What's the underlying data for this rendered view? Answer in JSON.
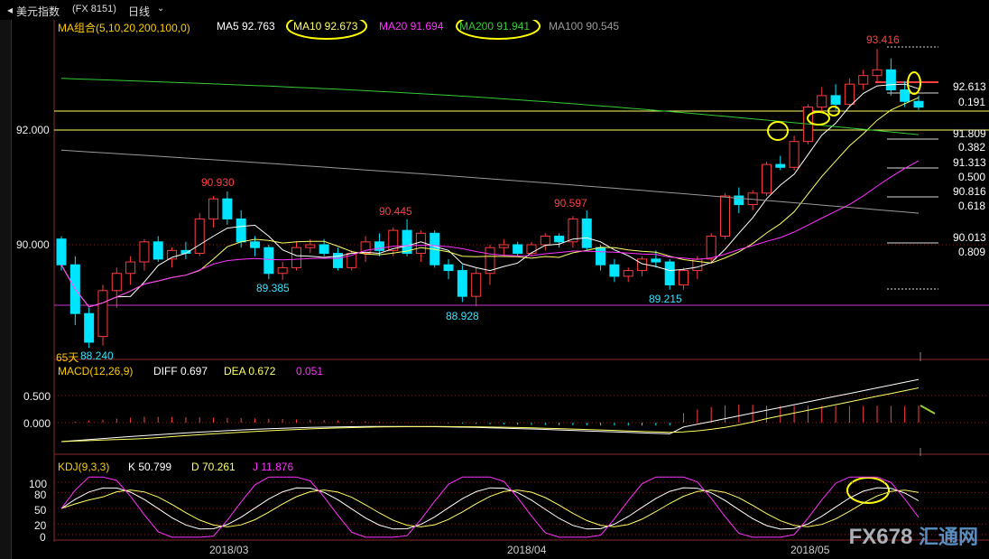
{
  "window": {
    "back_icon": "back-arrow-icon",
    "symbol": "美元指数",
    "code": "(FX 8151)",
    "period": "日线",
    "period_chevron": "chevron-down-icon"
  },
  "ma_legend": {
    "label": "MA组合(5,10,20,200,100,0)",
    "ma5": "MA5 92.763",
    "ma10": "MA10 92.673",
    "ma20": "MA20 91.694",
    "ma200": "MA200 91.941",
    "ma100": "MA100 90.545"
  },
  "price_axis": {
    "tick_92": "92.000",
    "tick_90": "90.000"
  },
  "price_annotations": {
    "high_label": "93.416",
    "p1": "90.930",
    "p2": "89.385",
    "p3": "90.445",
    "p4": "88.928",
    "p5": "90.597",
    "p6": "89.215",
    "low_label": "88.240",
    "low_prefix": "65天"
  },
  "fib_levels": [
    {
      "price": "92.613",
      "ratio": "0.191"
    },
    {
      "price": "91.809",
      "ratio": "0.382"
    },
    {
      "price": "91.313",
      "ratio": "0.500"
    },
    {
      "price": "90.816",
      "ratio": "0.618"
    },
    {
      "price": "90.013",
      "ratio": "0.809"
    }
  ],
  "macd": {
    "label": "MACD(12,26,9)",
    "diff": "DIFF 0.697",
    "dea": "DEA 0.672",
    "macd": "0.051",
    "tick_500": "0.500",
    "tick_000": "0.000"
  },
  "kdj": {
    "label": "KDJ(9,3,3)",
    "k": "K 50.799",
    "d": "D 70.261",
    "j": "J 11.876",
    "ticks": [
      "100",
      "80",
      "50",
      "20",
      "0"
    ]
  },
  "dates": [
    "2018/03",
    "2018/04",
    "2018/05"
  ],
  "watermark": {
    "en": "FX678",
    "cn": "汇通网"
  },
  "colors": {
    "up": "#ff3b3b",
    "down": "#00e5ff",
    "ma5": "#ffffff",
    "ma10": "#ffff66",
    "ma20": "#ff33ff",
    "ma200": "#33cc33",
    "ma100": "#999999",
    "highlight": "#ffff00"
  },
  "chart_data": {
    "type": "candlestick",
    "series_note": "US Dollar Index daily candles with moving averages",
    "ylim": [
      88.0,
      93.6
    ],
    "candles": [
      [
        90.1,
        90.15,
        89.55,
        89.65
      ],
      [
        89.65,
        89.8,
        88.6,
        88.8
      ],
      [
        88.8,
        88.9,
        88.2,
        88.3
      ],
      [
        88.4,
        89.3,
        88.24,
        89.2
      ],
      [
        89.2,
        89.6,
        88.9,
        89.5
      ],
      [
        89.5,
        89.8,
        89.3,
        89.7
      ],
      [
        89.7,
        90.1,
        89.55,
        90.05
      ],
      [
        90.05,
        90.15,
        89.7,
        89.75
      ],
      [
        89.75,
        89.95,
        89.6,
        89.9
      ],
      [
        89.9,
        90.05,
        89.75,
        89.85
      ],
      [
        89.85,
        90.55,
        89.8,
        90.45
      ],
      [
        90.45,
        90.85,
        90.3,
        90.8
      ],
      [
        90.8,
        90.93,
        90.35,
        90.45
      ],
      [
        90.45,
        90.6,
        89.95,
        90.05
      ],
      [
        90.05,
        90.15,
        89.8,
        89.95
      ],
      [
        89.95,
        90.0,
        89.4,
        89.5
      ],
      [
        89.5,
        89.7,
        89.385,
        89.6
      ],
      [
        89.6,
        90.05,
        89.55,
        89.95
      ],
      [
        89.95,
        90.1,
        89.85,
        90.0
      ],
      [
        90.0,
        90.1,
        89.8,
        89.85
      ],
      [
        89.85,
        89.95,
        89.55,
        89.6
      ],
      [
        89.6,
        89.9,
        89.55,
        89.85
      ],
      [
        89.85,
        90.15,
        89.7,
        90.05
      ],
      [
        90.05,
        90.2,
        89.8,
        89.9
      ],
      [
        89.9,
        90.3,
        89.8,
        90.25
      ],
      [
        90.25,
        90.445,
        89.8,
        89.85
      ],
      [
        89.85,
        90.25,
        89.7,
        90.2
      ],
      [
        90.2,
        90.25,
        89.6,
        89.65
      ],
      [
        89.65,
        89.75,
        89.4,
        89.55
      ],
      [
        89.55,
        89.65,
        89.0,
        89.1
      ],
      [
        89.1,
        89.6,
        88.928,
        89.5
      ],
      [
        89.5,
        90.0,
        89.3,
        89.95
      ],
      [
        89.95,
        90.1,
        89.8,
        90.0
      ],
      [
        90.0,
        90.05,
        89.8,
        89.85
      ],
      [
        89.85,
        90.05,
        89.8,
        90.0
      ],
      [
        90.0,
        90.2,
        89.9,
        90.15
      ],
      [
        90.15,
        90.2,
        89.95,
        90.05
      ],
      [
        90.05,
        90.5,
        89.95,
        90.45
      ],
      [
        90.45,
        90.597,
        89.9,
        89.95
      ],
      [
        89.95,
        90.0,
        89.55,
        89.65
      ],
      [
        89.65,
        89.75,
        89.35,
        89.45
      ],
      [
        89.45,
        89.6,
        89.35,
        89.55
      ],
      [
        89.55,
        89.8,
        89.45,
        89.75
      ],
      [
        89.75,
        89.9,
        89.6,
        89.7
      ],
      [
        89.7,
        89.75,
        89.215,
        89.3
      ],
      [
        89.3,
        89.6,
        89.215,
        89.55
      ],
      [
        89.55,
        89.8,
        89.4,
        89.75
      ],
      [
        89.75,
        90.2,
        89.7,
        90.15
      ],
      [
        90.15,
        90.9,
        90.1,
        90.85
      ],
      [
        90.85,
        91.0,
        90.55,
        90.7
      ],
      [
        90.7,
        90.95,
        90.6,
        90.9
      ],
      [
        90.9,
        91.45,
        90.85,
        91.4
      ],
      [
        91.4,
        91.55,
        91.3,
        91.35
      ],
      [
        91.35,
        91.9,
        91.3,
        91.8
      ],
      [
        91.8,
        92.45,
        91.75,
        92.4
      ],
      [
        92.4,
        92.75,
        92.3,
        92.6
      ],
      [
        92.6,
        92.8,
        92.35,
        92.45
      ],
      [
        92.45,
        92.9,
        92.4,
        92.8
      ],
      [
        92.8,
        93.05,
        92.7,
        92.95
      ],
      [
        92.95,
        93.416,
        92.85,
        93.05
      ],
      [
        93.05,
        93.25,
        92.6,
        92.7
      ],
      [
        92.7,
        92.85,
        92.4,
        92.5
      ],
      [
        92.5,
        92.6,
        92.35,
        92.4
      ]
    ]
  }
}
